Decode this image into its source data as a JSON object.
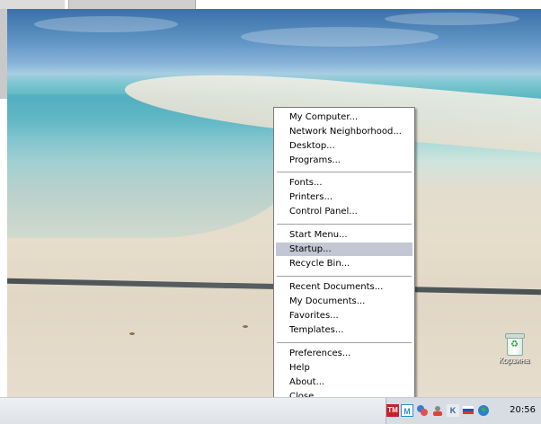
{
  "menu": {
    "items": [
      {
        "label": "My Computer..."
      },
      {
        "label": "Network Neighborhood..."
      },
      {
        "label": "Desktop..."
      },
      {
        "label": "Programs..."
      },
      {
        "label": "Fonts..."
      },
      {
        "label": "Printers..."
      },
      {
        "label": "Control Panel..."
      },
      {
        "label": "Start Menu..."
      },
      {
        "label": "Startup...",
        "highlighted": true
      },
      {
        "label": "Recycle Bin..."
      },
      {
        "label": "Recent Documents..."
      },
      {
        "label": "My Documents..."
      },
      {
        "label": "Favorites..."
      },
      {
        "label": "Templates..."
      },
      {
        "label": "Preferences..."
      },
      {
        "label": "Help"
      },
      {
        "label": "About..."
      },
      {
        "label": "Close"
      }
    ]
  },
  "desktop": {
    "recycle_bin_label": "Корзина"
  },
  "tray": {
    "icons": [
      "tm-icon",
      "m-icon",
      "network-icon",
      "security-icon",
      "k-icon",
      "flag-icon",
      "globe-icon"
    ],
    "tm_label": "TM",
    "m_label": "M",
    "k_label": "K",
    "clock": "20:56"
  },
  "colors": {
    "menu_highlight": "#c3c7d3",
    "tm_icon": "#c8202a",
    "m_icon": "#2a8fd0"
  }
}
